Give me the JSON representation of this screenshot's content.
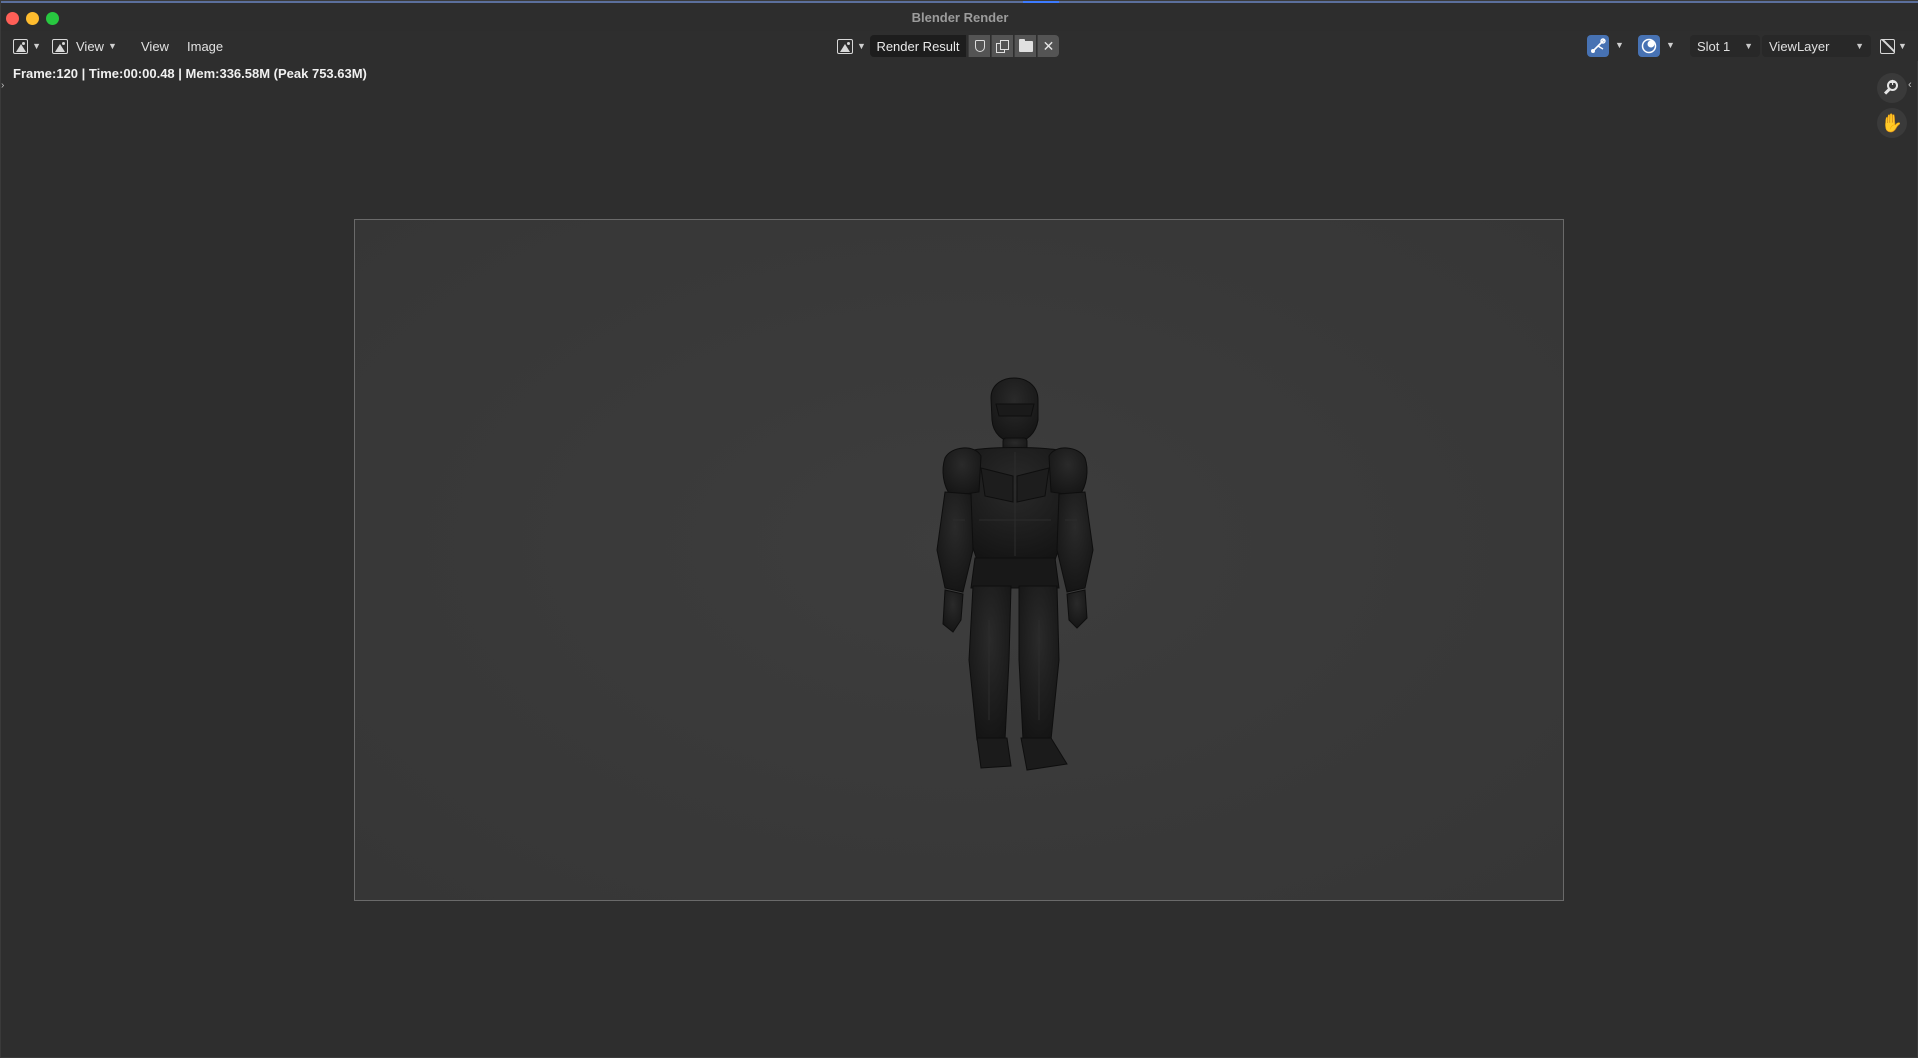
{
  "window": {
    "title": "Blender Render"
  },
  "header": {
    "editor_type_icon": "image-editor-icon",
    "view_dropdown_label": "View",
    "menus": [
      "View",
      "Image"
    ],
    "image_field": "Render Result",
    "tool_icons": [
      "fake-user-shield-icon",
      "duplicate-icon",
      "folder-open-icon",
      "close-icon"
    ],
    "slot": "Slot 1",
    "view_layer": "ViewLayer",
    "gizmo_icons": [
      "gizmo-icon",
      "overlay-icon"
    ]
  },
  "info": {
    "text": "Frame:120 | Time:00:00.48 | Mem:336.58M (Peak 753.63M)"
  },
  "navigation": {
    "zoom_icon": "zoom-icon",
    "pan_icon": "hand-pan-icon"
  },
  "colors": {
    "accent": "#4772b3",
    "background": "#2e2e2e",
    "render_bg": "#3a3a3a",
    "close": "#ff5f57",
    "minimize": "#febc2e",
    "maximize": "#28c840"
  }
}
